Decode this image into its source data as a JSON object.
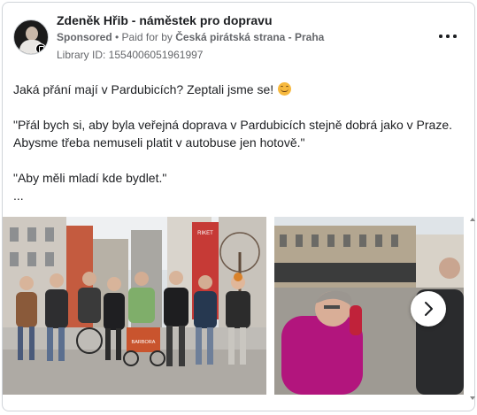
{
  "post": {
    "page_name": "Zdeněk Hřib - náměstek pro dopravu",
    "sponsored_label": "Sponsored",
    "paid_for_prefix": " • Paid for by ",
    "payer": "Česká pirátská strana - Praha",
    "library_id": "Library ID: 1554006051961997",
    "text": {
      "line1": "Jaká přání mají v Pardubicích? Zeptali jsme se!",
      "quote1": "\"Přál bych si, aby byla veřejná doprava v Pardubicích stejně dobrá jako v Praze.\nAbysme třeba nemuseli platit v autobuse jen hotově.\"",
      "quote2": "\"Aby měli mladí kde bydlet.\"",
      "ellipsis": "..."
    },
    "emoji": "smiling-face-emoji"
  },
  "carousel": {
    "photos": [
      {
        "name": "group-photo",
        "sign_text": "BARBORA"
      },
      {
        "name": "woman-photo"
      }
    ],
    "next_icon": "chevron-right-icon"
  },
  "colors": {
    "text_primary": "#1c1e21",
    "text_secondary": "#65676b",
    "border": "#d0d4d9"
  }
}
